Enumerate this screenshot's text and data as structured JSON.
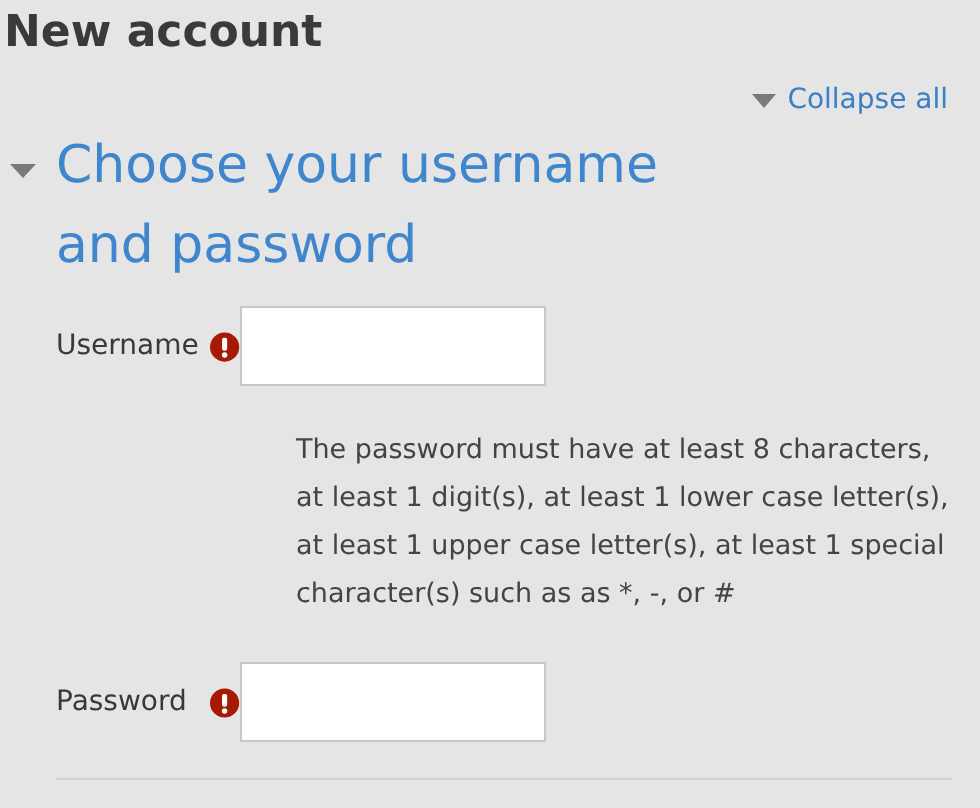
{
  "page_title": "New account",
  "collapse_all": {
    "label": "Collapse all"
  },
  "section": {
    "title": "Choose your username and password",
    "expanded": true,
    "rows": [
      {
        "kind": "input",
        "label": "Username",
        "required": true
      },
      {
        "kind": "help",
        "text": "The password must have at least 8 characters, at least 1 digit(s), at least 1 lower case letter(s), at least 1 upper case letter(s), at least 1 special character(s) such as as *, -, or #"
      },
      {
        "kind": "input",
        "label": "Password",
        "required": true
      }
    ]
  }
}
